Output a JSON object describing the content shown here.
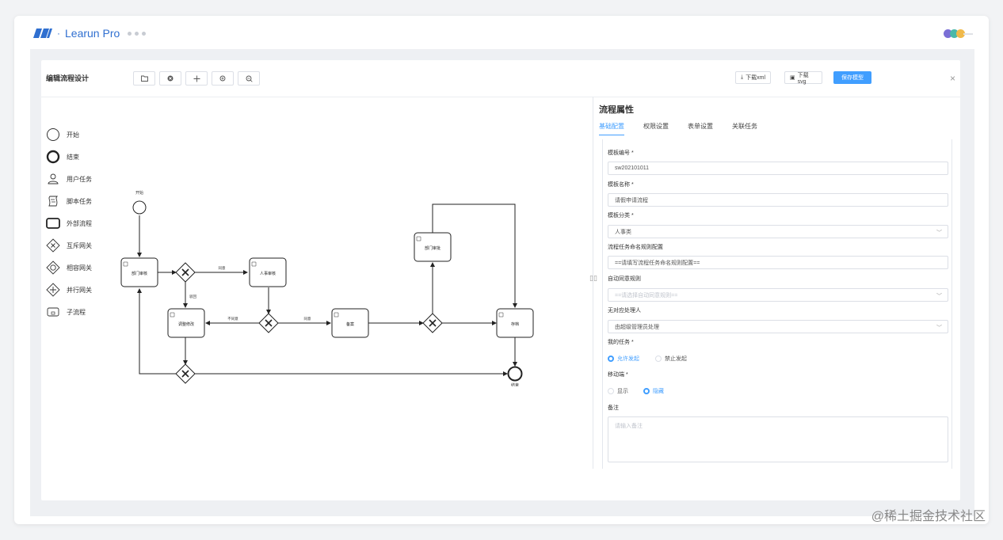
{
  "app": {
    "brand": "Learun Pro",
    "separator": "·"
  },
  "editor": {
    "title": "编辑流程设计",
    "download_xml": "下载xml",
    "download_svg": "下载svg",
    "save_model": "保存模型",
    "close": "×"
  },
  "toolbar_icons": [
    "folder-open-icon",
    "close-circle-icon",
    "move-icon",
    "zoom-in-icon",
    "zoom-out-icon"
  ],
  "palette": [
    {
      "label": "开始",
      "icon": "start-event-icon"
    },
    {
      "label": "结束",
      "icon": "end-event-icon"
    },
    {
      "label": "用户任务",
      "icon": "user-task-icon"
    },
    {
      "label": "脚本任务",
      "icon": "script-task-icon"
    },
    {
      "label": "外部流程",
      "icon": "external-process-icon"
    },
    {
      "label": "互斥网关",
      "icon": "exclusive-gateway-icon"
    },
    {
      "label": "相容网关",
      "icon": "inclusive-gateway-icon"
    },
    {
      "label": "并行网关",
      "icon": "parallel-gateway-icon"
    },
    {
      "label": "子流程",
      "icon": "subprocess-icon"
    }
  ],
  "diagram": {
    "start": "开始",
    "end": "结束",
    "task_dept_review": "部门审核",
    "task_hr_review": "人事审核",
    "task_adjust": "调整修改",
    "task_record": "备案",
    "task_dept_approve": "部门审批",
    "task_archive": "存档",
    "flow_agree": "同意",
    "flow_reject": "驳回",
    "flow_disagree": "不同意",
    "flow_agree2": "同意"
  },
  "panel": {
    "title": "流程属性",
    "tabs": [
      "基础配置",
      "权限设置",
      "表单设置",
      "关联任务"
    ],
    "template_code_label": "模板编号 *",
    "template_code_value": "sw202101011",
    "template_name_label": "模板名称 *",
    "template_name_value": "请假申请流程",
    "template_category_label": "模板分类 *",
    "template_category_value": "人事类",
    "naming_rule_label": "流程任务命名规则配置",
    "naming_rule_value": "==请填写流程任务命名规则配置==",
    "auto_agree_label": "自动同意规则",
    "auto_agree_placeholder": "==请选择自动同意规则==",
    "no_handler_label": "无对应处理人",
    "no_handler_value": "由超级管理员处理",
    "my_task_label": "我的任务 *",
    "my_task_options": [
      "允许发起",
      "禁止发起"
    ],
    "mobile_label": "移动端 *",
    "mobile_options": [
      "显示",
      "隐藏"
    ],
    "remark_label": "备注",
    "remark_placeholder": "请输入备注"
  },
  "colors": {
    "accent": "#409eff",
    "brand": "#2f6fd0",
    "dot1": "#7b6fd6",
    "dot2": "#4bb8a9",
    "dot3": "#f0b94a"
  },
  "watermark": "@稀土掘金技术社区"
}
